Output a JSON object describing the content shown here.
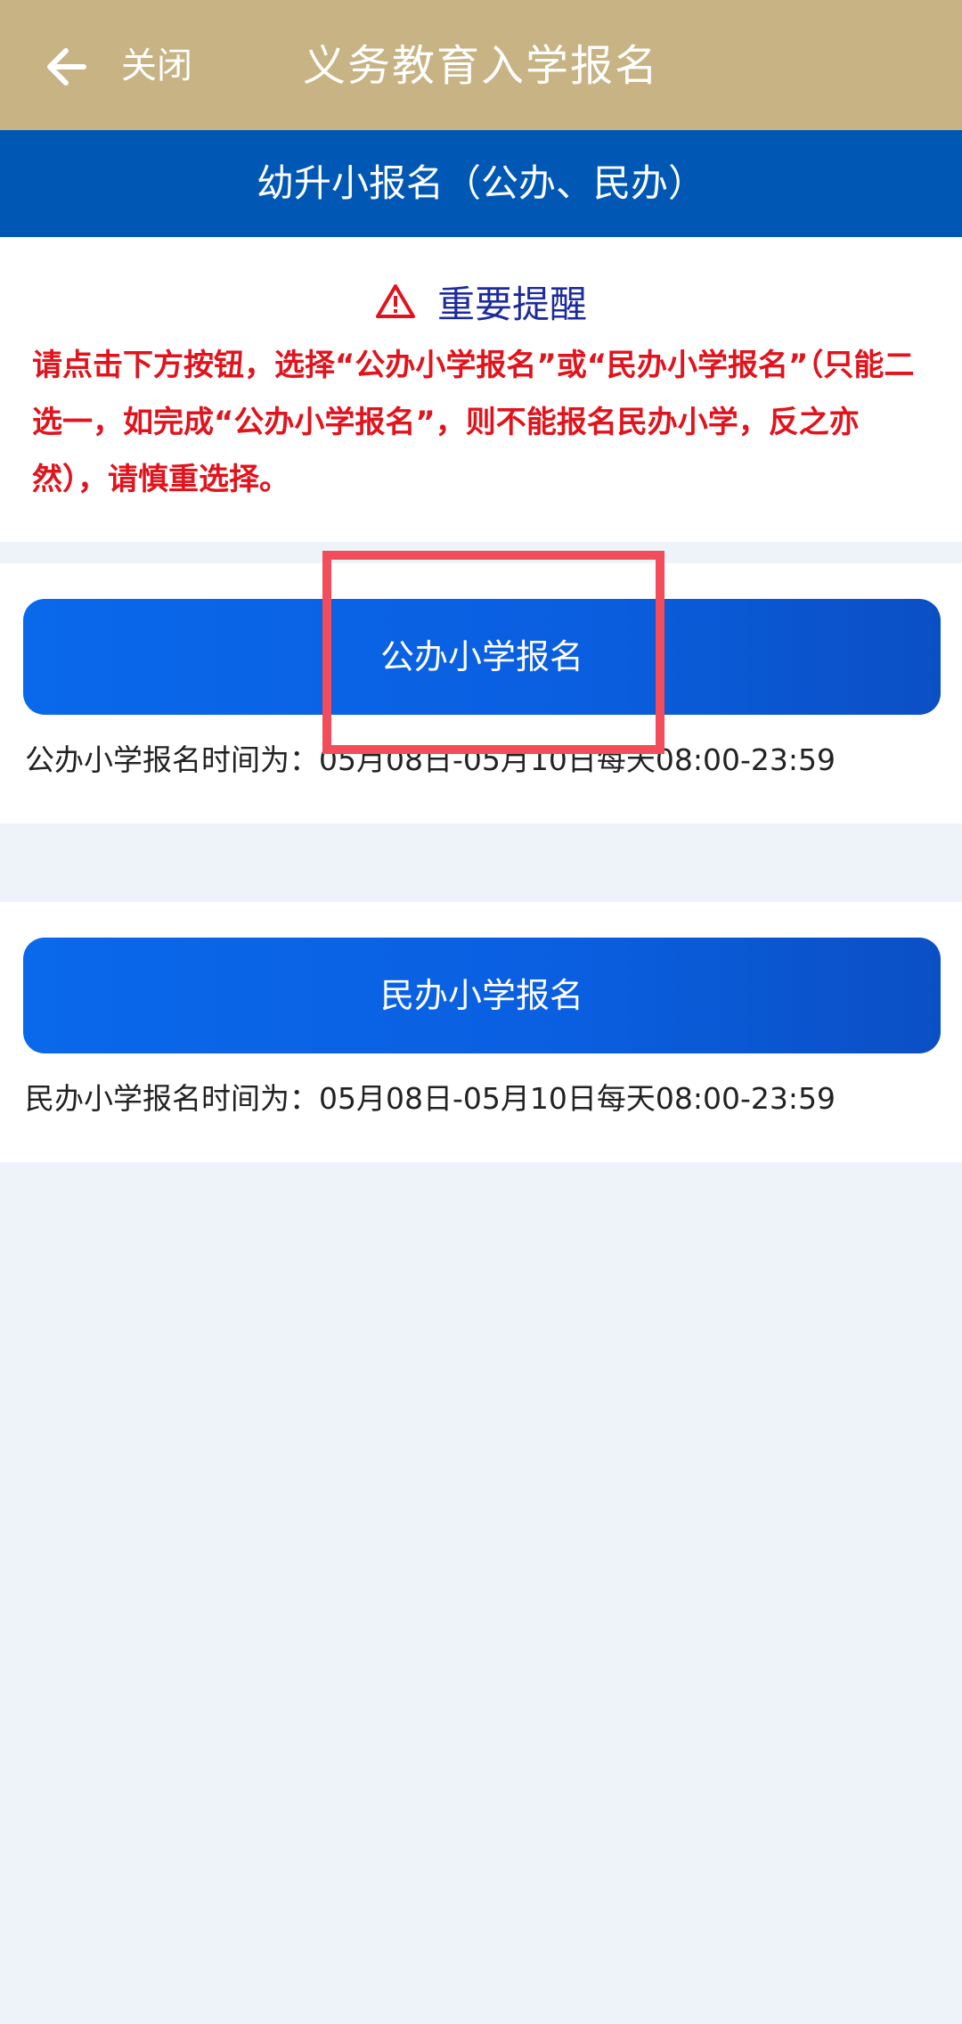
{
  "app_bar": {
    "title": "义务教育入学报名",
    "close_label": "关闭"
  },
  "section": {
    "title": "幼升小报名（公办、民办）"
  },
  "notice": {
    "title": "重要提醒",
    "text": "请点击下方按钮，选择“公办小学报名”或“民办小学报名”（只能二选一，如完成“公办小学报名”，则不能报名民办小学，反之亦然），请慎重选择。"
  },
  "options": [
    {
      "button_label": "公办小学报名",
      "time_text": "公办小学报名时间为：05月08日-05月10日每天08:00-23:59"
    },
    {
      "button_label": "民办小学报名",
      "time_text": "民办小学报名时间为：05月08日-05月10日每天08:00-23:59"
    }
  ],
  "colors": {
    "app_bar": "#c7b383",
    "section_header": "#0058b4",
    "notice_text": "#e1131c",
    "notice_title": "#1d2b9c",
    "button": "#0a62e4",
    "highlight": "#f24d5a",
    "page_bg": "#eef3fa"
  },
  "icons": {
    "back": "arrow-left-icon",
    "warning": "warning-triangle-icon"
  }
}
